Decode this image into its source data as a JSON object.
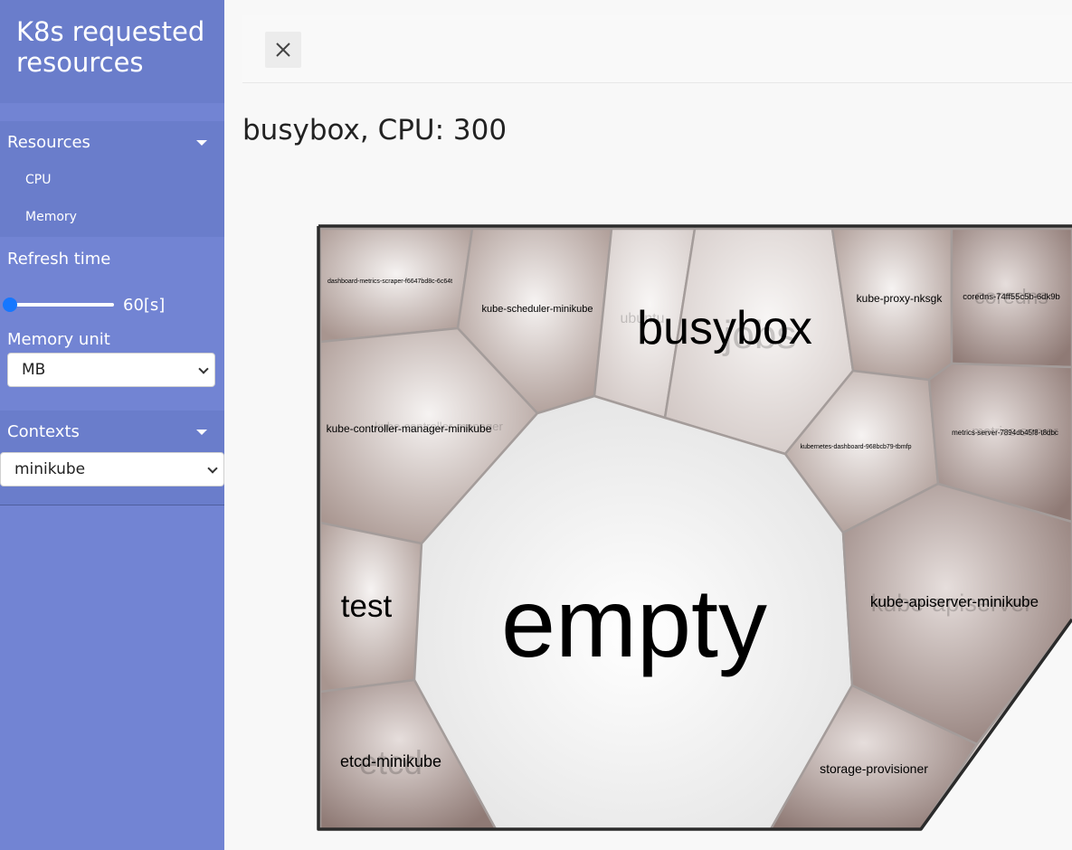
{
  "brand": {
    "title": "K8s requested resources"
  },
  "sidebar": {
    "resources": {
      "label": "Resources",
      "items": [
        "CPU",
        "Memory"
      ]
    },
    "refresh": {
      "label": "Refresh time",
      "value": 60,
      "value_text": "60[s]"
    },
    "memory_unit": {
      "label": "Memory unit",
      "selected": "MB"
    },
    "contexts": {
      "label": "Contexts",
      "selected": "minikube"
    }
  },
  "header": {
    "close_icon": "close-icon"
  },
  "page": {
    "title": "busybox, CPU: 300"
  },
  "treemap": {
    "cells": [
      {
        "name": "dashboard-metrics-scraper-f6647bd8c-6c64t"
      },
      {
        "name": "kube-scheduler-minikube"
      },
      {
        "name": "busybox",
        "background_label": "jobs"
      },
      {
        "name": "ubuntu"
      },
      {
        "name": "kube-proxy-nksgk"
      },
      {
        "name": "coredns-74ff55c5b-6dk9b",
        "background_label": "coredns"
      },
      {
        "name": "kube-controller-manager-minikube",
        "background_label": "kube-controller-manager"
      },
      {
        "name": "kubernetes-dashboard-968bcb79-tbmfp"
      },
      {
        "name": "metrics-server-7894db45f8-t8dbc",
        "background_label": "metrics-server"
      },
      {
        "name": "test"
      },
      {
        "name": "empty"
      },
      {
        "name": "kube-apiserver-minikube",
        "background_label": "kube-apiserver"
      },
      {
        "name": "etcd-minikube",
        "background_label": "etcd"
      },
      {
        "name": "storage-provisioner"
      }
    ],
    "colors": {
      "cell_dark": "#9c8884",
      "cell_light": "#f4f0ef",
      "empty": "#f7f7f7",
      "border": "#2b2b2b"
    }
  }
}
